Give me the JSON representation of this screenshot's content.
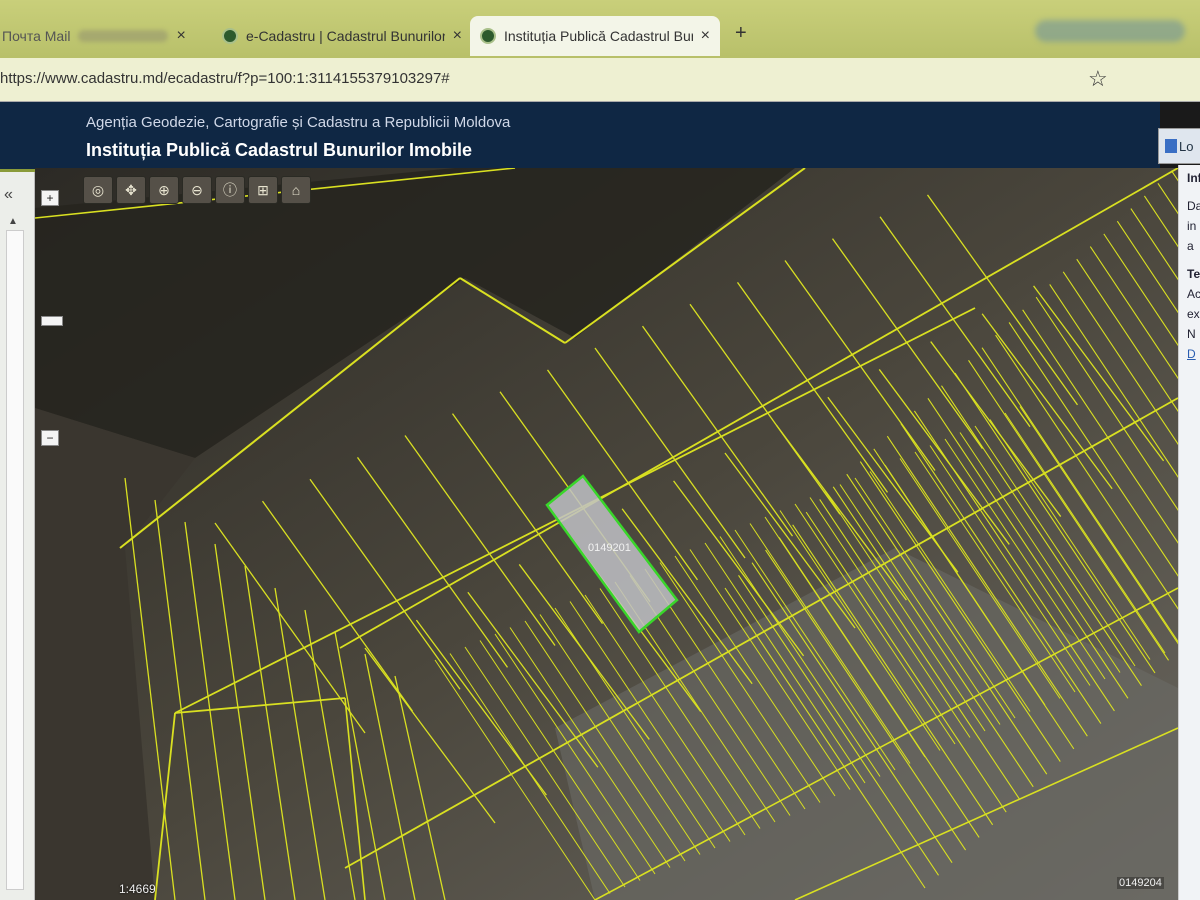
{
  "browser": {
    "tabs": [
      {
        "label": "Почта Mail",
        "active": false
      },
      {
        "label": "e-Cadastru | Cadastrul Bunurilor",
        "active": false
      },
      {
        "label": "Instituția Publică Cadastrul Bun",
        "active": true
      }
    ],
    "close_glyph": "×",
    "new_tab_glyph": "+",
    "url": "https://www.cadastru.md/ecadastru/f?p=100:1:3114155379103297#"
  },
  "site": {
    "agency": "Agenția Geodezie, Cartografie și Cadastru a Republicii Moldova",
    "institution": "Instituția Publică Cadastrul Bunurilor Imobile",
    "login_label": "Lo"
  },
  "info_panel": {
    "lines": [
      "Inf",
      "Da",
      "in",
      "a",
      "Te",
      "Ac",
      "ex",
      "N",
      "D"
    ]
  },
  "left_panel": {
    "collapse_glyph": "«"
  },
  "map": {
    "zoom_in": "+",
    "zoom_out": "−",
    "tools": [
      "pan-icon",
      "move-icon",
      "zoom-in-icon",
      "zoom-out-icon",
      "info-icon",
      "measure-icon",
      "home-icon"
    ],
    "selected_parcel_label": "0149201",
    "neighbor_label": "0149204",
    "scale": "1:4669",
    "colors": {
      "parcel_line": "#d9e021",
      "selected_line": "#39d62a",
      "selected_fill": "#bfc1c6"
    }
  }
}
